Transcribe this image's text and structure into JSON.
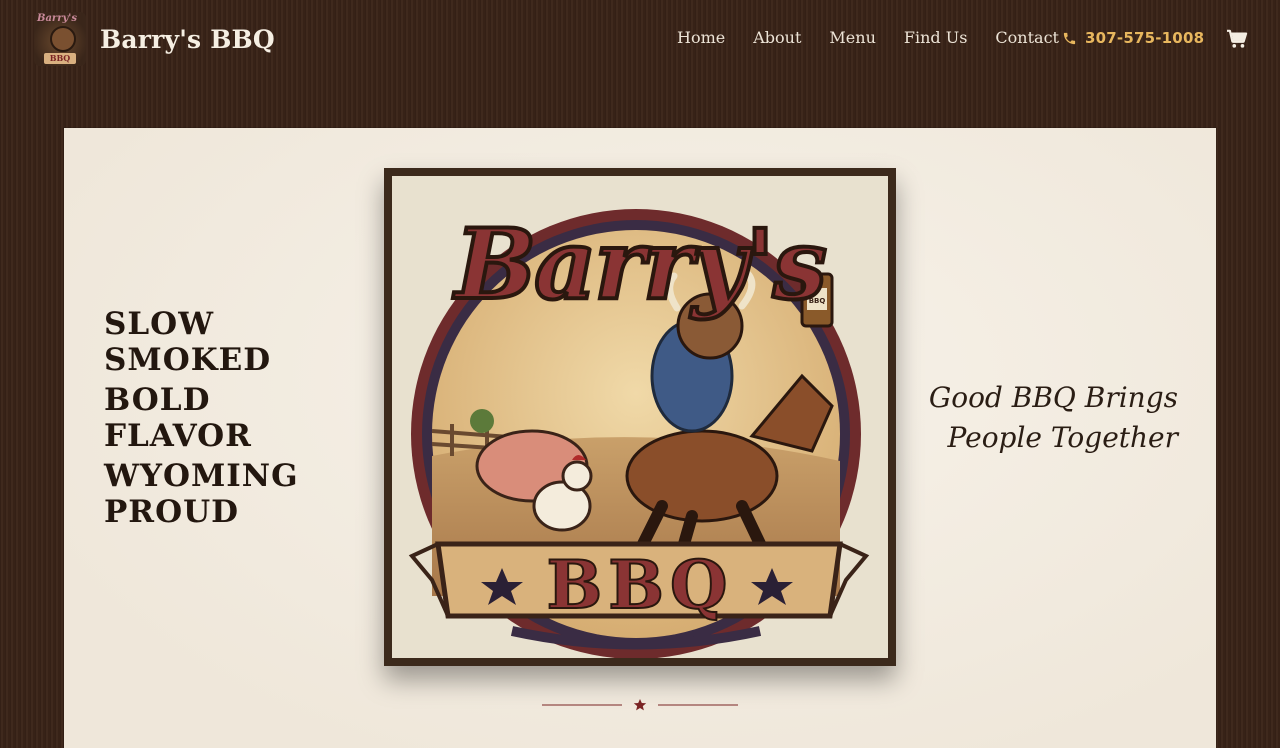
{
  "brand": {
    "name": "Barry's BBQ",
    "logo_mini_script": "Barry's",
    "logo_mini_banner": "BBQ"
  },
  "nav": {
    "links": [
      "Home",
      "About",
      "Menu",
      "Find Us",
      "Contact"
    ]
  },
  "contact": {
    "phone": "307-575-1008",
    "phone_icon": "phone-icon"
  },
  "cart": {
    "icon": "cart-icon"
  },
  "hero": {
    "tagline_left": [
      "SLOW",
      "SMOKED",
      "BOLD",
      "FLAVOR",
      "WYOMING",
      "PROUD"
    ],
    "tagline_right": [
      "Good BBQ Brings",
      "People Together"
    ],
    "logo": {
      "script_title": "Barry's",
      "banner_text": "BBQ",
      "bottle_label": "BBQ"
    }
  },
  "colors": {
    "header_bg": "#3a2418",
    "accent_gold": "#e8b75e",
    "hero_bg": "#f2ece1",
    "brand_red": "#7a2424",
    "text_dark": "#23170f"
  }
}
